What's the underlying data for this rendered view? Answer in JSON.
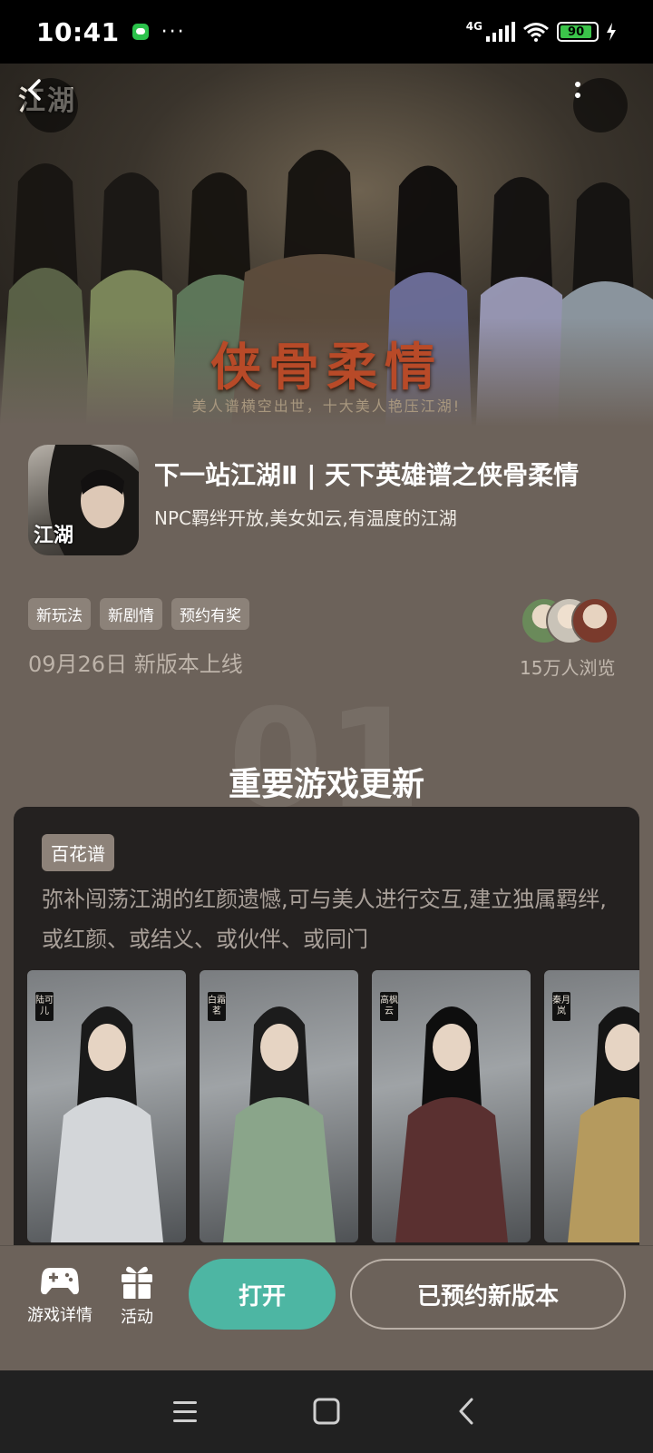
{
  "status_bar": {
    "time": "10:41",
    "dots": "···",
    "network": "4G",
    "battery": "90"
  },
  "hero": {
    "logo": "江湖",
    "title": "侠骨柔情",
    "subtitle": "美人谱横空出世，十大美人艳压江湖!"
  },
  "app": {
    "name": "下一站江湖Ⅱ | 天下英雄谱之侠骨柔情",
    "description": "NPC羁绊开放,美女如云,有温度的江湖",
    "icon_text": "江湖"
  },
  "tags": [
    "新玩法",
    "新剧情",
    "预约有奖"
  ],
  "release": "09月26日 新版本上线",
  "viewers": "15万人浏览",
  "section": {
    "number": "01",
    "title": "重要游戏更新"
  },
  "update_card": {
    "tag": "百花谱",
    "description": "弥补闯荡江湖的红颜遗憾,可与美人进行交互,建立独属羁绊,或红颜、或结义、或伙伴、或同门",
    "portraits": [
      {
        "name": "陆可儿",
        "dress": "#d3d6d9",
        "hair": "#1a1a1a"
      },
      {
        "name": "白霜茗",
        "dress": "#8aa58a",
        "hair": "#1c1c1c"
      },
      {
        "name": "高枫云",
        "dress": "#5a3030",
        "hair": "#0e0e0e"
      },
      {
        "name": "秦月岚",
        "dress": "#b59a5e",
        "hair": "#151515"
      }
    ]
  },
  "bottom_bar": {
    "details_label": "游戏详情",
    "activity_label": "活动",
    "open_label": "打开",
    "reserved_label": "已预约新版本"
  },
  "colors": {
    "background": "#6c625a",
    "accent": "#4db6a3",
    "card": "#242120"
  }
}
